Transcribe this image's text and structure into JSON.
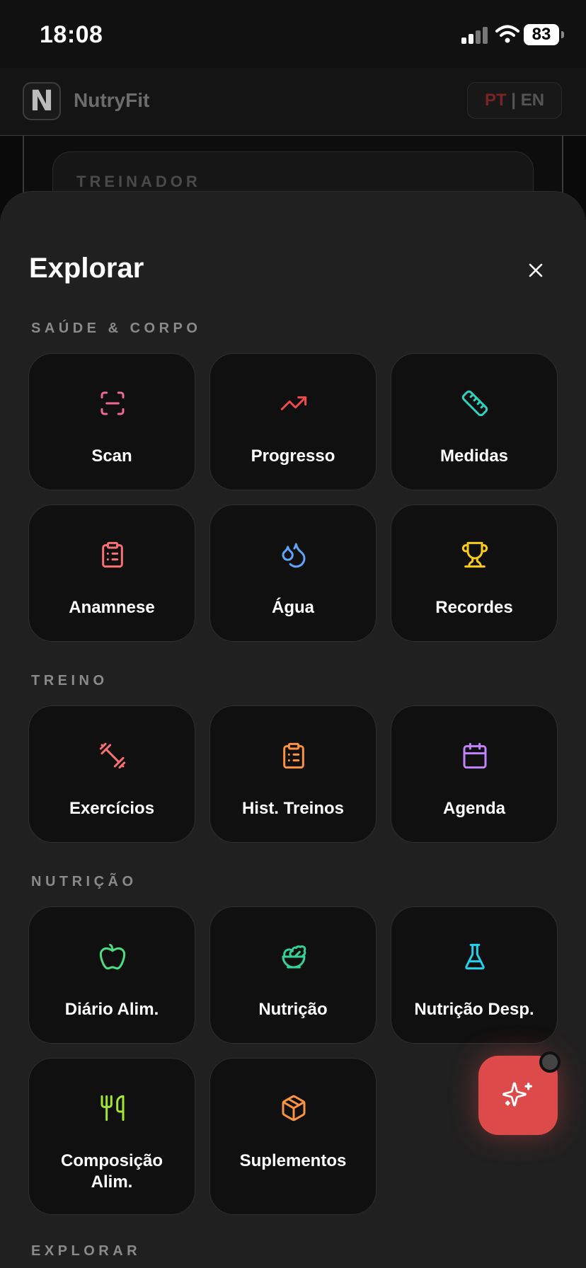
{
  "status_bar": {
    "time": "18:08",
    "battery": "83"
  },
  "header": {
    "logo": "N",
    "app_name": "NutryFit",
    "lang_pt": "PT",
    "lang_sep": " | ",
    "lang_en": "EN"
  },
  "background": {
    "card_title": "TREINADOR"
  },
  "sheet": {
    "title": "Explorar",
    "sections": [
      {
        "title": "SAÚDE & CORPO",
        "items": [
          {
            "label": "Scan",
            "icon": "scan-icon",
            "color": "#f0679a"
          },
          {
            "label": "Progresso",
            "icon": "trending-up-icon",
            "color": "#ef4b4b"
          },
          {
            "label": "Medidas",
            "icon": "ruler-icon",
            "color": "#2dd4bf"
          },
          {
            "label": "Anamnese",
            "icon": "clipboard-list-icon",
            "color": "#f87171"
          },
          {
            "label": "Água",
            "icon": "droplets-icon",
            "color": "#60a5fa"
          },
          {
            "label": "Recordes",
            "icon": "trophy-icon",
            "color": "#facc15"
          }
        ]
      },
      {
        "title": "TREINO",
        "items": [
          {
            "label": "Exercícios",
            "icon": "dumbbell-icon",
            "color": "#f87171"
          },
          {
            "label": "Hist. Treinos",
            "icon": "clipboard-list-icon",
            "color": "#fb923c"
          },
          {
            "label": "Agenda",
            "icon": "calendar-icon",
            "color": "#c084fc"
          }
        ]
      },
      {
        "title": "NUTRIÇÃO",
        "items": [
          {
            "label": "Diário Alim.",
            "icon": "apple-icon",
            "color": "#4ade80"
          },
          {
            "label": "Nutrição",
            "icon": "salad-icon",
            "color": "#34d399"
          },
          {
            "label": "Nutrição Desp.",
            "icon": "flask-icon",
            "color": "#22d3ee"
          },
          {
            "label": "Composição Alim.",
            "icon": "utensils-icon",
            "color": "#a3e635"
          },
          {
            "label": "Suplementos",
            "icon": "package-icon",
            "color": "#fb923c"
          }
        ]
      },
      {
        "title": "EXPLORAR",
        "items": []
      }
    ]
  },
  "fab": {
    "icon": "sparkles-icon"
  }
}
